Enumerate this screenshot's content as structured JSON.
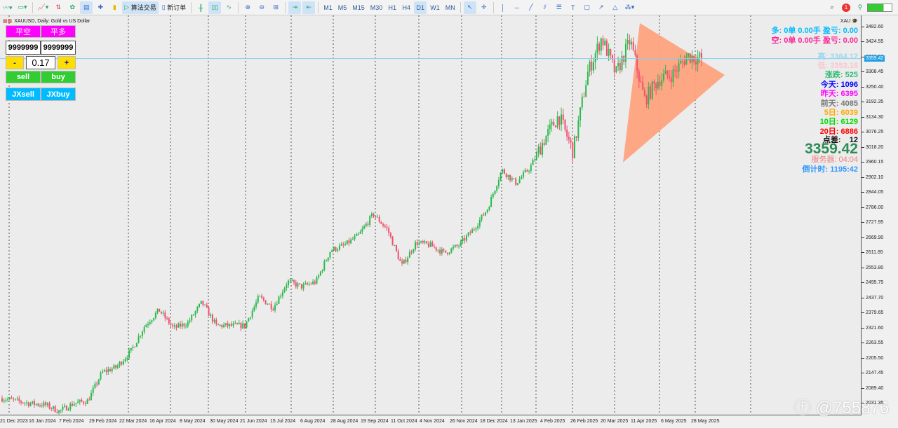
{
  "toolbar": {
    "algo_label": "算法交易",
    "new_order_label": "新订单",
    "timeframes": [
      "M1",
      "M5",
      "M15",
      "M30",
      "H1",
      "H4",
      "D1",
      "W1",
      "MN"
    ],
    "active_timeframe": "D1",
    "notification_count": "1"
  },
  "chart": {
    "title": "XAUUSD, Daily:  Gold vs US Dollar",
    "symbol_label": "XAU",
    "current_price": "3359.42"
  },
  "panel": {
    "close_short": "平空",
    "close_long": "平多",
    "input_left": "9999999",
    "input_right": "9999999",
    "minus": "-",
    "lot": "0.17",
    "plus": "+",
    "sell": "sell",
    "buy": "buy",
    "jxsell": "JXsell",
    "jxbuy": "JXbuy"
  },
  "info": {
    "long_line": "多: 0单  0.00手  盈亏: 0.00",
    "short_line": "空: 0单  0.00手  盈亏: 0.00",
    "high": "高: 3364.12",
    "low": "低: 3353.16",
    "change": "涨跌: 525",
    "today": "今天: 1096",
    "yesterday": "昨天: 6395",
    "day_before": "前天: 4085",
    "d5": "5日: 6039",
    "d10": "10日: 6129",
    "d20": "20日: 6886",
    "spread_label": "点差:",
    "spread": "12",
    "price": "3359.42",
    "server": "服务器: 04:04",
    "countdown": "倒计时: 1195:42"
  },
  "watermark": "@755876",
  "chart_data": {
    "type": "candlestick",
    "yticks": [
      "3482.60",
      "3424.55",
      "3366.50",
      "3308.45",
      "3250.40",
      "3192.35",
      "3134.30",
      "3076.25",
      "3018.20",
      "2960.15",
      "2902.10",
      "2844.05",
      "2786.00",
      "2727.95",
      "2669.90",
      "2611.85",
      "2553.80",
      "2495.75",
      "2437.70",
      "2379.65",
      "2321.60",
      "2263.55",
      "2205.50",
      "2147.45",
      "2089.40",
      "2031.35"
    ],
    "xticks": [
      "21 Dec 2023",
      "16 Jan 2024",
      "7 Feb 2024",
      "29 Feb 2024",
      "22 Mar 2024",
      "16 Apr 2024",
      "8 May 2024",
      "30 May 2024",
      "21 Jun 2024",
      "15 Jul 2024",
      "6 Aug 2024",
      "28 Aug 2024",
      "19 Sep 2024",
      "11 Oct 2024",
      "4 Nov 2024",
      "26 Nov 2024",
      "18 Dec 2024",
      "13 Jan 2025",
      "4 Feb 2025",
      "26 Feb 2025",
      "20 Mar 2025",
      "11 Apr 2025",
      "6 May 2025",
      "28 May 2025"
    ],
    "close_path": [
      2050,
      2040,
      2030,
      2025,
      2000,
      2030,
      2040,
      2150,
      2170,
      2230,
      2330,
      2390,
      2320,
      2340,
      2420,
      2330,
      2330,
      2330,
      2440,
      2400,
      2500,
      2480,
      2500,
      2620,
      2640,
      2680,
      2760,
      2700,
      2560,
      2650,
      2640,
      2610,
      2640,
      2700,
      2780,
      2930,
      2880,
      2940,
      3050,
      3140,
      3000,
      3300,
      3440,
      3300,
      3430,
      3200,
      3280,
      3300,
      3370,
      3359.42
    ],
    "triangle": [
      [
        3495,
        "11 Apr 2025"
      ],
      [
        3290,
        "future"
      ],
      [
        2955,
        "20 Mar 2025"
      ]
    ]
  }
}
